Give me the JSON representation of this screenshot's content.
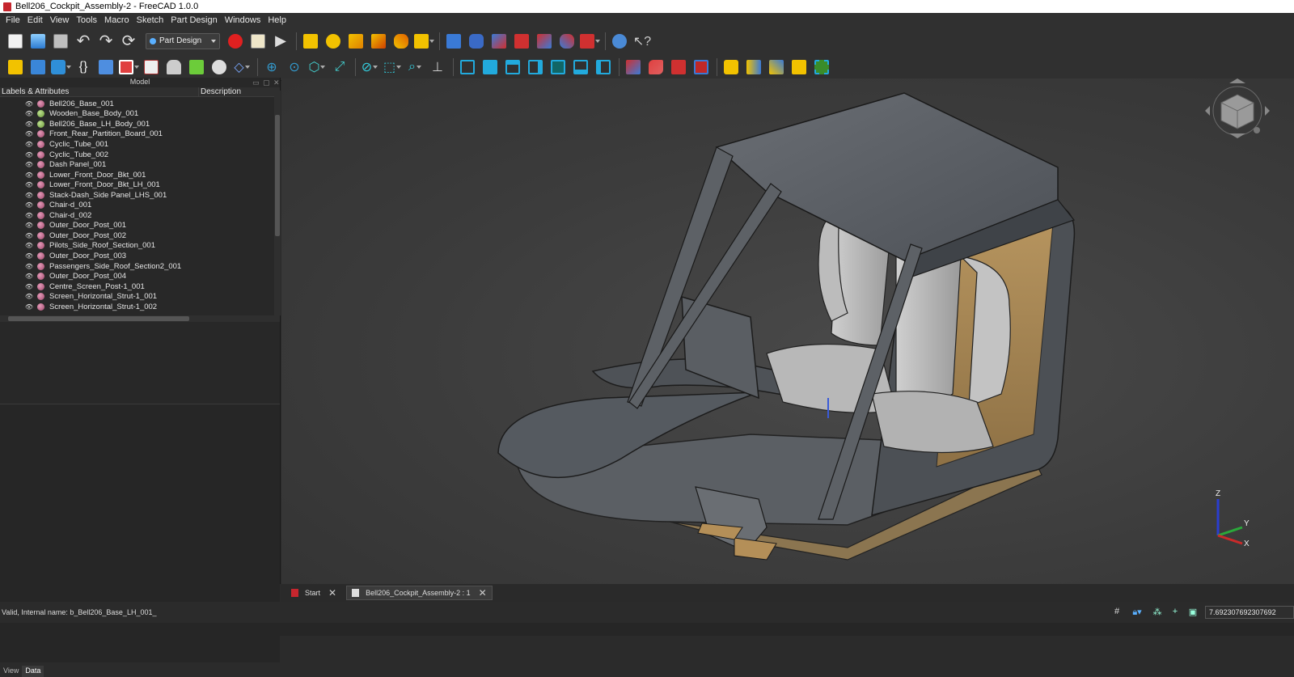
{
  "window": {
    "title": "Bell206_Cockpit_Assembly-2 - FreeCAD 1.0.0"
  },
  "menu": [
    "File",
    "Edit",
    "View",
    "Tools",
    "Macro",
    "Sketch",
    "Part Design",
    "Windows",
    "Help"
  ],
  "toolbar": {
    "workbench": "Part Design"
  },
  "panel": {
    "title": "Model",
    "col_labels": "Labels & Attributes",
    "col_description": "Description"
  },
  "tree": [
    {
      "label": "Bell206_Base_001",
      "color": "pink"
    },
    {
      "label": "Wooden_Base_Body_001",
      "color": "green"
    },
    {
      "label": "Bell206_Base_LH_Body_001",
      "color": "green"
    },
    {
      "label": "Front_Rear_Partition_Board_001",
      "color": "pink"
    },
    {
      "label": "Cyclic_Tube_001",
      "color": "pink"
    },
    {
      "label": "Cyclic_Tube_002",
      "color": "pink"
    },
    {
      "label": "Dash Panel_001",
      "color": "pink"
    },
    {
      "label": "Lower_Front_Door_Bkt_001",
      "color": "pink"
    },
    {
      "label": "Lower_Front_Door_Bkt_LH_001",
      "color": "pink"
    },
    {
      "label": "Stack-Dash_Side Panel_LHS_001",
      "color": "pink"
    },
    {
      "label": "Chair-d_001",
      "color": "pink"
    },
    {
      "label": "Chair-d_002",
      "color": "pink"
    },
    {
      "label": "Outer_Door_Post_001",
      "color": "pink"
    },
    {
      "label": "Outer_Door_Post_002",
      "color": "pink"
    },
    {
      "label": "Pilots_Side_Roof_Section_001",
      "color": "pink"
    },
    {
      "label": "Outer_Door_Post_003",
      "color": "pink"
    },
    {
      "label": "Passengers_Side_Roof_Section2_001",
      "color": "pink"
    },
    {
      "label": "Outer_Door_Post_004",
      "color": "pink"
    },
    {
      "label": "Centre_Screen_Post-1_001",
      "color": "pink"
    },
    {
      "label": "Screen_Horizontal_Strut-1_001",
      "color": "pink"
    },
    {
      "label": "Screen_Horizontal_Strut-1_002",
      "color": "pink"
    }
  ],
  "left_tabs": [
    "View",
    "Data"
  ],
  "doc_tabs": [
    "Start",
    "Bell206_Cockpit_Assembly-2 : 1"
  ],
  "status": {
    "message": "Valid, Internal name: b_Bell206_Base_LH_001_",
    "coordinate": "7.692307692307692"
  },
  "axis": {
    "x": "X",
    "y": "Y",
    "z": "Z"
  }
}
